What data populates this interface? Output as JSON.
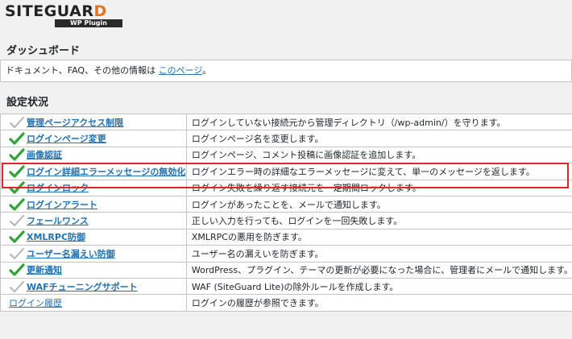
{
  "logo": {
    "main_prefix": "SITEGUAR",
    "main_accent": "D",
    "sub": "WP Plugin"
  },
  "page_title": "ダッシュボード",
  "notice": {
    "text": "ドキュメント、FAQ、その他の情報は ",
    "link": "このページ",
    "suffix": "。"
  },
  "section_title": "設定状況",
  "rows": [
    {
      "feature": "管理ページアクセス制限",
      "enabled": false,
      "description": "ログインしていない接続元から管理ディレクトリ（/wp-admin/）を守ります。"
    },
    {
      "feature": "ログインページ変更",
      "enabled": true,
      "description": "ログインページ名を変更します。"
    },
    {
      "feature": "画像認証",
      "enabled": true,
      "description": "ログインページ、コメント投稿に画像認証を追加します。"
    },
    {
      "feature": "ログイン詳細エラーメッセージの無効化",
      "enabled": true,
      "description": "ログインエラー時の詳細なエラーメッセージに変えて、単一のメッセージを返します。"
    },
    {
      "feature": "ログインロック",
      "enabled": true,
      "description": "ログイン失敗を繰り返す接続元を一定期間ロックします。"
    },
    {
      "feature": "ログインアラート",
      "enabled": true,
      "description": "ログインがあったことを、メールで通知します。"
    },
    {
      "feature": "フェールワンス",
      "enabled": false,
      "description": "正しい入力を行っても、ログインを一回失敗します。"
    },
    {
      "feature": "XMLRPC防御",
      "enabled": true,
      "description": "XMLRPCの悪用を防ぎます。"
    },
    {
      "feature": "ユーザー名漏えい防御",
      "enabled": false,
      "description": "ユーザー名の漏えいを防ぎます。"
    },
    {
      "feature": "更新通知",
      "enabled": true,
      "description": "WordPress、プラグイン、テーマの更新が必要になった場合に、管理者にメールで通知します。"
    },
    {
      "feature": "WAFチューニングサポート",
      "enabled": false,
      "description": "WAF (SiteGuard Lite)の除外ルールを作成します。"
    },
    {
      "feature": "ログイン履歴",
      "enabled": null,
      "description": "ログインの履歴が参照できます。"
    }
  ],
  "colors": {
    "check_on": "#31a33a",
    "check_off": "#b4b4b4",
    "link": "#2271b1",
    "highlight": "#e0252b"
  }
}
